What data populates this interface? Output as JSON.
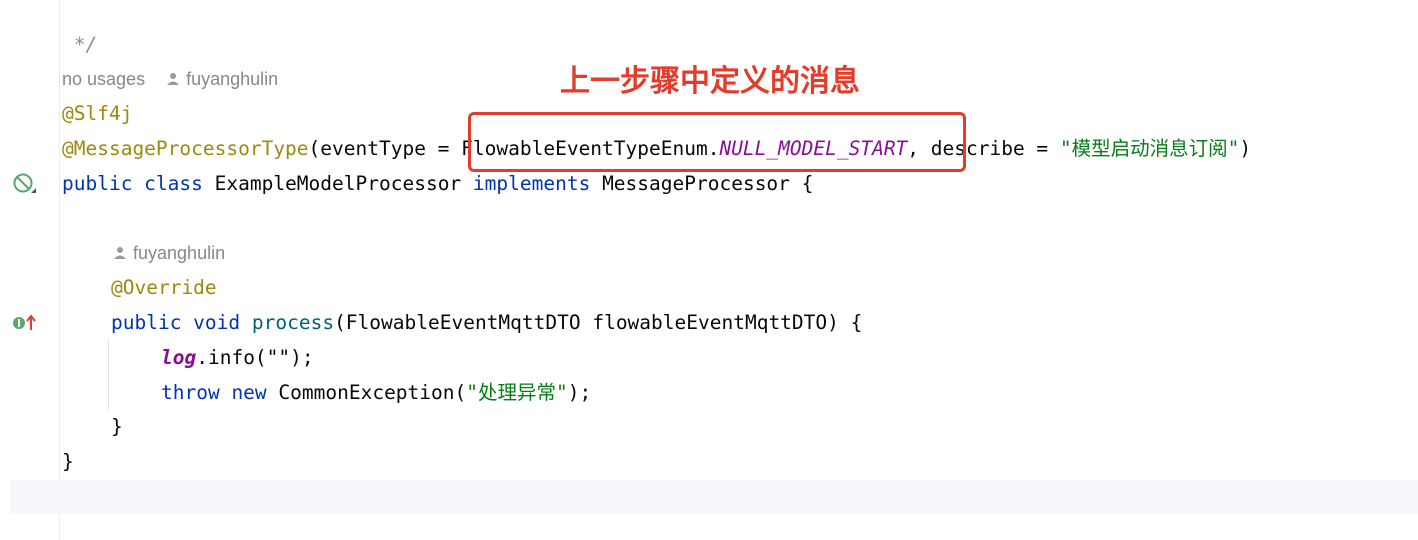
{
  "editor": {
    "comment_end": " */",
    "usages_label": "no usages",
    "author": "fuyanghulin",
    "lines": {
      "slf4j": "@Slf4j",
      "mpt_annotation": "@MessageProcessorType",
      "mpt_open": "(eventType = ",
      "enum_class": "FlowableEventTypeEnum.",
      "enum_const": "NULL_MODEL_START",
      "mpt_describe": ", describe = ",
      "describe_value": "\"模型启动消息订阅\"",
      "mpt_close": ")",
      "kw_public_class": "public class",
      "class_name": " ExampleModelProcessor ",
      "kw_implements": "implements",
      "class_tail": " MessageProcessor {",
      "override": "@Override",
      "kw_public_void": "public void",
      "method_name": " process",
      "method_params": "(FlowableEventMqttDTO flowableEventMqttDTO) {",
      "log_var": "log",
      "log_call": ".info(\"\");",
      "kw_throw_new": "throw new",
      "exception_call": " CommonException(",
      "exception_msg": "\"处理异常\"",
      "exception_end": ");",
      "close_method": "}",
      "close_class": "}"
    }
  },
  "annotation_callout": {
    "text": "上一步骤中定义的消息",
    "color": "#e23c2c"
  },
  "gutter_icons": [
    "no-entry-icon",
    "implements-method-icon"
  ],
  "colors": {
    "keyword": "#0033b3",
    "annotation": "#9e880d",
    "string": "#067d17",
    "method": "#00627a",
    "constant": "#871094",
    "hint": "#888888"
  }
}
